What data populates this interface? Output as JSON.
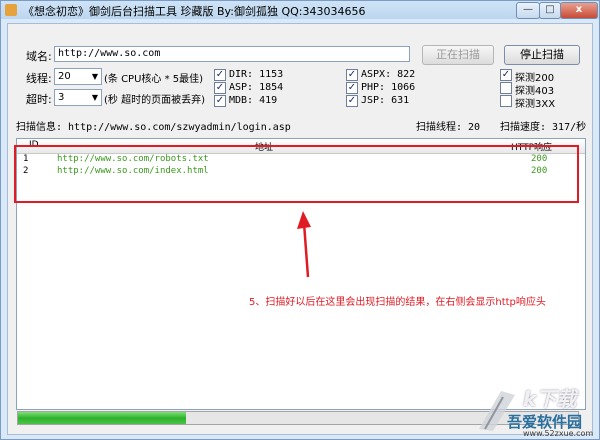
{
  "window": {
    "title": "《想念初恋》御剑后台扫描工具 珍藏版 By:御剑孤独 QQ:343034656",
    "minimize": "—",
    "maximize": "□",
    "close": "x"
  },
  "form": {
    "domain_label": "域名:",
    "domain_value": "http://www.so.com",
    "threads_label": "线程:",
    "threads_value": "20",
    "threads_hint": "(条 CPU核心 * 5最佳)",
    "timeout_label": "超时:",
    "timeout_value": "3",
    "timeout_hint": "(秒 超时的页面被丢弃)",
    "dropdown_arrow": "▼"
  },
  "buttons": {
    "scanning": "正在扫描",
    "stop": "停止扫描"
  },
  "dicts": [
    {
      "label": "DIR: 1153",
      "checked": true
    },
    {
      "label": "ASP: 1854",
      "checked": true
    },
    {
      "label": "MDB: 419",
      "checked": true
    },
    {
      "label": "ASPX: 822",
      "checked": true
    },
    {
      "label": "PHP: 1066",
      "checked": true
    },
    {
      "label": "JSP: 631",
      "checked": true
    }
  ],
  "probes": [
    {
      "label": "探测200",
      "checked": true
    },
    {
      "label": "探测403",
      "checked": false
    },
    {
      "label": "探测3XX",
      "checked": false
    }
  ],
  "check_mark": "✓",
  "status": {
    "scan_info": "扫描信息: http://www.so.com/szwyadmin/login.asp",
    "scan_threads": "扫描线程: 20",
    "scan_speed": "扫描速度: 317/秒"
  },
  "table": {
    "columns": [
      "ID",
      "地址",
      "HTTP响应"
    ],
    "rows": [
      {
        "id": "1",
        "url": "http://www.so.com/robots.txt",
        "code": "200"
      },
      {
        "id": "2",
        "url": "http://www.so.com/index.html",
        "code": "200"
      }
    ]
  },
  "annotation": "5、扫描好以后在这里会出现扫描的结果，在右侧会显示http响应头",
  "progress": 0.3,
  "watermark": {
    "brand_small": "k下载",
    "name": "吾爱软件园",
    "domain": "www.52zxue.com"
  },
  "colors": {
    "annotation_red": "#e01b24",
    "url_green": "#3b9a1e",
    "progress_green": "#2fb12b"
  }
}
